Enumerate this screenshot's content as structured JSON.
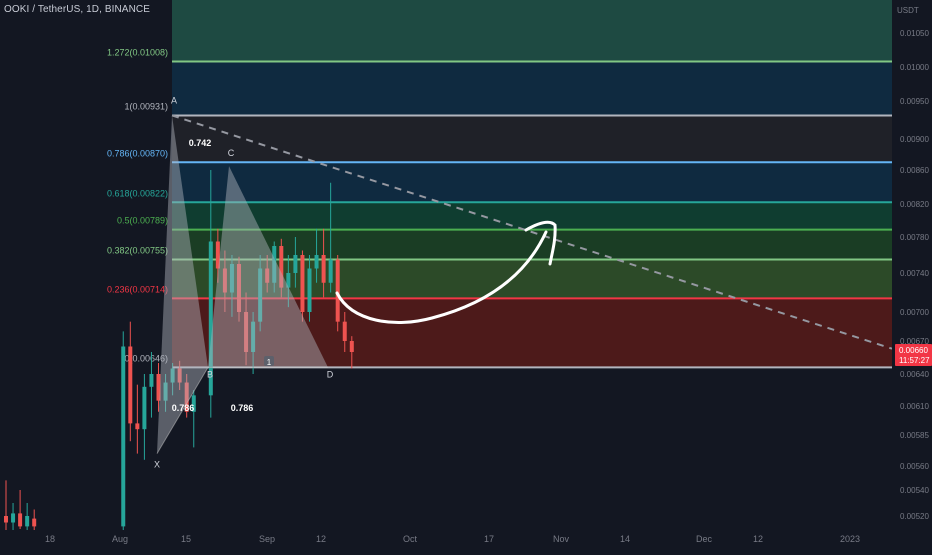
{
  "chart_data": {
    "type": "candlestick",
    "symbol": "OOKI / TetherUS, 1D, BINANCE",
    "y_axis": {
      "unit_label": "USDT",
      "range": [
        0.00505,
        0.01085
      ],
      "ticks": [
        "0.01050",
        "0.01000",
        "0.00950",
        "0.00900",
        "0.00860",
        "0.00820",
        "0.00780",
        "0.00740",
        "0.00700",
        "0.00670",
        "0.00640",
        "0.00610",
        "0.00585",
        "0.00560",
        "0.00540",
        "0.00520"
      ]
    },
    "x_axis": {
      "ticks": [
        "18",
        "Aug",
        "15",
        "Sep",
        "12",
        "Oct",
        "17",
        "Nov",
        "14",
        "Dec",
        "12",
        "2023"
      ]
    },
    "last_price": {
      "value": "0.00660",
      "countdown": "11:57:27"
    },
    "fib_levels": [
      {
        "label": "1.272(0.01008)",
        "price": 0.01008,
        "color": "#81c784"
      },
      {
        "label": "1(0.00931)",
        "price": 0.00931,
        "color": "#b2b5be"
      },
      {
        "label": "0.786(0.00870)",
        "price": 0.0087,
        "color": "#64b5f6"
      },
      {
        "label": "0.618(0.00822)",
        "price": 0.00822,
        "color": "#26a69a"
      },
      {
        "label": "0.5(0.00789)",
        "price": 0.00789,
        "color": "#4caf50"
      },
      {
        "label": "0.382(0.00755)",
        "price": 0.00755,
        "color": "#81c784"
      },
      {
        "label": "0.236(0.00714)",
        "price": 0.00714,
        "color": "#f23645"
      },
      {
        "label": "0(0.00646)",
        "price": 0.00646,
        "color": "#b2b5be"
      }
    ],
    "fib_zone_colors": [
      "#1e4a42",
      "#0f2a40",
      "#1f2128",
      "#0f2a40",
      "#0f3d30",
      "#1a3d24",
      "#2c4a28",
      "#4d1a1a"
    ],
    "pattern_points": {
      "X": {
        "price": 0.0057
      },
      "A": {
        "price": 0.00931
      },
      "B": {
        "price": 0.00646
      },
      "C": {
        "price": 0.00865
      },
      "D": {
        "price": 0.00646
      }
    },
    "pattern_ratio_labels": [
      "0.742",
      "0.786",
      "0.786"
    ],
    "trendline_end_price": 0.00663,
    "candles": [
      {
        "o": 0.0052,
        "h": 0.00548,
        "l": 0.00508,
        "c": 0.00515
      },
      {
        "o": 0.00515,
        "h": 0.0053,
        "l": 0.00505,
        "c": 0.00522
      },
      {
        "o": 0.00522,
        "h": 0.0054,
        "l": 0.0051,
        "c": 0.00512
      },
      {
        "o": 0.00512,
        "h": 0.0053,
        "l": 0.00506,
        "c": 0.0052
      },
      {
        "o": 0.00518,
        "h": 0.00525,
        "l": 0.00508,
        "c": 0.00512
      },
      {
        "o": 0.00512,
        "h": 0.0068,
        "l": 0.00508,
        "c": 0.00665
      },
      {
        "o": 0.00665,
        "h": 0.0069,
        "l": 0.0058,
        "c": 0.00595
      },
      {
        "o": 0.00595,
        "h": 0.0063,
        "l": 0.0057,
        "c": 0.0059
      },
      {
        "o": 0.0059,
        "h": 0.0064,
        "l": 0.00565,
        "c": 0.00628
      },
      {
        "o": 0.00628,
        "h": 0.0066,
        "l": 0.006,
        "c": 0.0064
      },
      {
        "o": 0.0064,
        "h": 0.0065,
        "l": 0.00605,
        "c": 0.00615
      },
      {
        "o": 0.00615,
        "h": 0.0064,
        "l": 0.00605,
        "c": 0.00632
      },
      {
        "o": 0.00632,
        "h": 0.0065,
        "l": 0.0062,
        "c": 0.00645
      },
      {
        "o": 0.00645,
        "h": 0.00652,
        "l": 0.00625,
        "c": 0.00632
      },
      {
        "o": 0.00632,
        "h": 0.0064,
        "l": 0.006,
        "c": 0.00605
      },
      {
        "o": 0.00605,
        "h": 0.00625,
        "l": 0.00575,
        "c": 0.0062
      },
      {
        "o": 0.0062,
        "h": 0.0086,
        "l": 0.006,
        "c": 0.00775
      },
      {
        "o": 0.00775,
        "h": 0.0079,
        "l": 0.0073,
        "c": 0.00745
      },
      {
        "o": 0.00745,
        "h": 0.00765,
        "l": 0.007,
        "c": 0.0072
      },
      {
        "o": 0.0072,
        "h": 0.0076,
        "l": 0.00695,
        "c": 0.0075
      },
      {
        "o": 0.0075,
        "h": 0.00758,
        "l": 0.0069,
        "c": 0.007
      },
      {
        "o": 0.007,
        "h": 0.0072,
        "l": 0.00648,
        "c": 0.0066
      },
      {
        "o": 0.0066,
        "h": 0.007,
        "l": 0.0064,
        "c": 0.0069
      },
      {
        "o": 0.0069,
        "h": 0.0076,
        "l": 0.0068,
        "c": 0.00745
      },
      {
        "o": 0.00745,
        "h": 0.0076,
        "l": 0.0072,
        "c": 0.0073
      },
      {
        "o": 0.0073,
        "h": 0.00775,
        "l": 0.0072,
        "c": 0.0077
      },
      {
        "o": 0.0077,
        "h": 0.00778,
        "l": 0.00715,
        "c": 0.00725
      },
      {
        "o": 0.00725,
        "h": 0.0076,
        "l": 0.00705,
        "c": 0.0074
      },
      {
        "o": 0.0074,
        "h": 0.0078,
        "l": 0.00725,
        "c": 0.0076
      },
      {
        "o": 0.0076,
        "h": 0.00765,
        "l": 0.0069,
        "c": 0.007
      },
      {
        "o": 0.007,
        "h": 0.0076,
        "l": 0.0069,
        "c": 0.00745
      },
      {
        "o": 0.00745,
        "h": 0.0079,
        "l": 0.0073,
        "c": 0.0076
      },
      {
        "o": 0.0076,
        "h": 0.0079,
        "l": 0.00715,
        "c": 0.0073
      },
      {
        "o": 0.0073,
        "h": 0.00845,
        "l": 0.0072,
        "c": 0.00755
      },
      {
        "o": 0.00755,
        "h": 0.0076,
        "l": 0.0068,
        "c": 0.0069
      },
      {
        "o": 0.0069,
        "h": 0.007,
        "l": 0.0066,
        "c": 0.0067
      },
      {
        "o": 0.0067,
        "h": 0.00675,
        "l": 0.00645,
        "c": 0.0066
      }
    ]
  }
}
